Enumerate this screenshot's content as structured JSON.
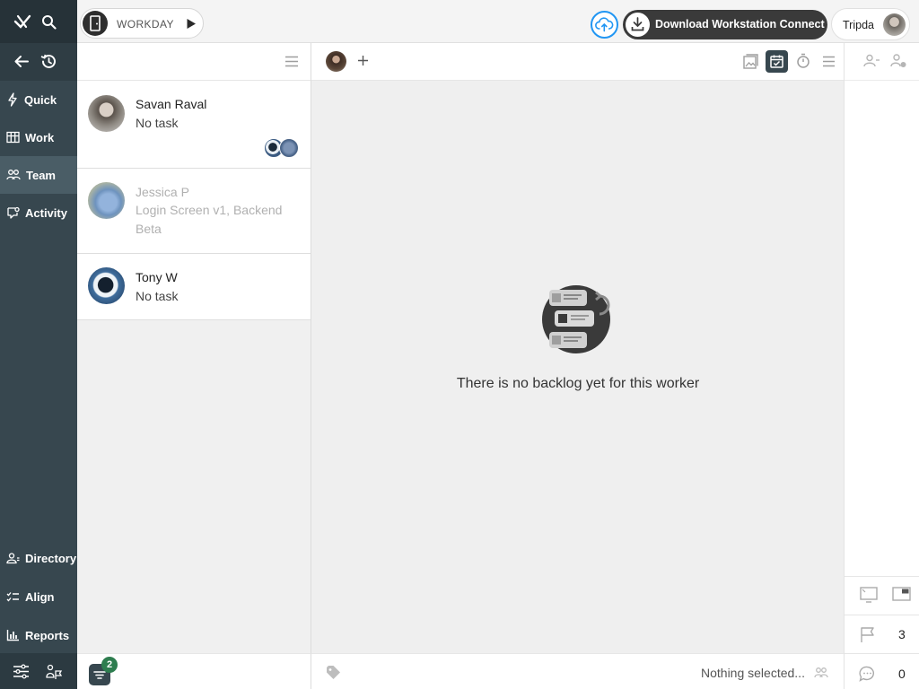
{
  "nav": {
    "items": [
      {
        "label": "Quick",
        "icon": "lightning-icon"
      },
      {
        "label": "Work",
        "icon": "board-icon"
      },
      {
        "label": "Team",
        "icon": "team-icon"
      },
      {
        "label": "Activity",
        "icon": "activity-icon"
      }
    ],
    "bottom_items": [
      {
        "label": "Directory",
        "icon": "directory-icon"
      },
      {
        "label": "Align",
        "icon": "checklist-icon"
      },
      {
        "label": "Reports",
        "icon": "bar-chart-icon"
      }
    ]
  },
  "topbar": {
    "workday_label": "WORKDAY",
    "download_label": "Download Workstation Connect",
    "user_name": "Tripda"
  },
  "workers": [
    {
      "name": "Savan Raval",
      "task": "No task"
    },
    {
      "name": "Jessica P",
      "task": "Login Screen v1, Backend Beta"
    },
    {
      "name": "Tony W",
      "task": "No task"
    }
  ],
  "filter_badge": "2",
  "main": {
    "empty_message": "There is no backlog yet for this worker",
    "footer_text": "Nothing selected..."
  },
  "right": {
    "flag_count": "3",
    "comment_count": "0"
  },
  "colors": {
    "rail": "#37474f",
    "rail_active": "#4a5d66",
    "accent_blue": "#2196f3",
    "badge_green": "#2e7d4f"
  }
}
